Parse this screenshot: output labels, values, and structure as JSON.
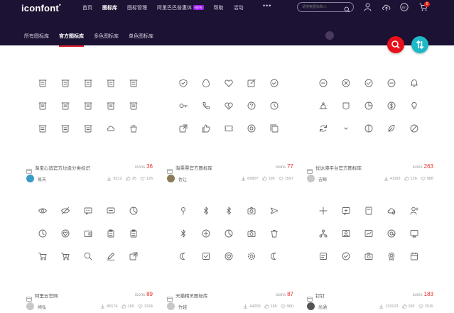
{
  "header": {
    "logo": "iconfont",
    "logo_mark": "*",
    "nav": [
      {
        "label": "首页",
        "active": false
      },
      {
        "label": "图标库",
        "active": true
      },
      {
        "label": "图标管理",
        "active": false
      },
      {
        "label": "阿里巴巴普惠体",
        "active": false,
        "badge": "NEW"
      },
      {
        "label": "帮助",
        "active": false
      },
      {
        "label": "活动",
        "active": false
      }
    ],
    "more": "•••",
    "search_placeholder": "请搜索图标和人",
    "cart_count": "0"
  },
  "subnav": [
    {
      "label": "所有图标库",
      "active": false
    },
    {
      "label": "官方图标库",
      "active": true
    },
    {
      "label": "多色图标库",
      "active": false
    },
    {
      "label": "单色图标库",
      "active": false
    }
  ],
  "count_label": "icons",
  "cards": [
    {
      "title": "淘宝心选官方垃圾分类标识",
      "count": "36",
      "author": "易天",
      "downloads": "8212",
      "likes": "35",
      "favorites": "126",
      "avatar_color": "#3a9ac8"
    },
    {
      "title": "淘票票官方图标库",
      "count": "77",
      "author": "佐让",
      "downloads": "69907",
      "likes": "195",
      "favorites": "1597",
      "avatar_color": "#8a7a5a"
    },
    {
      "title": "优达港平台官方图标库",
      "count": "263",
      "author": "吉鲸",
      "downloads": "41163",
      "likes": "126",
      "favorites": "988",
      "avatar_color": "#c8c8c8"
    },
    {
      "title": "阿里云官网",
      "count": "89",
      "author": "倾弘",
      "downloads": "80174",
      "likes": "169",
      "favorites": "1324",
      "avatar_color": "#c8c8c8"
    },
    {
      "title": "天猫精灵图标库",
      "count": "87",
      "author": "竹越",
      "downloads": "64205",
      "likes": "165",
      "favorites": "960",
      "avatar_color": "#c8c8c8"
    },
    {
      "title": "钉钉",
      "count": "183",
      "author": "尚通",
      "downloads": "133123",
      "likes": "292",
      "favorites": "2515",
      "avatar_color": "#555555"
    }
  ]
}
